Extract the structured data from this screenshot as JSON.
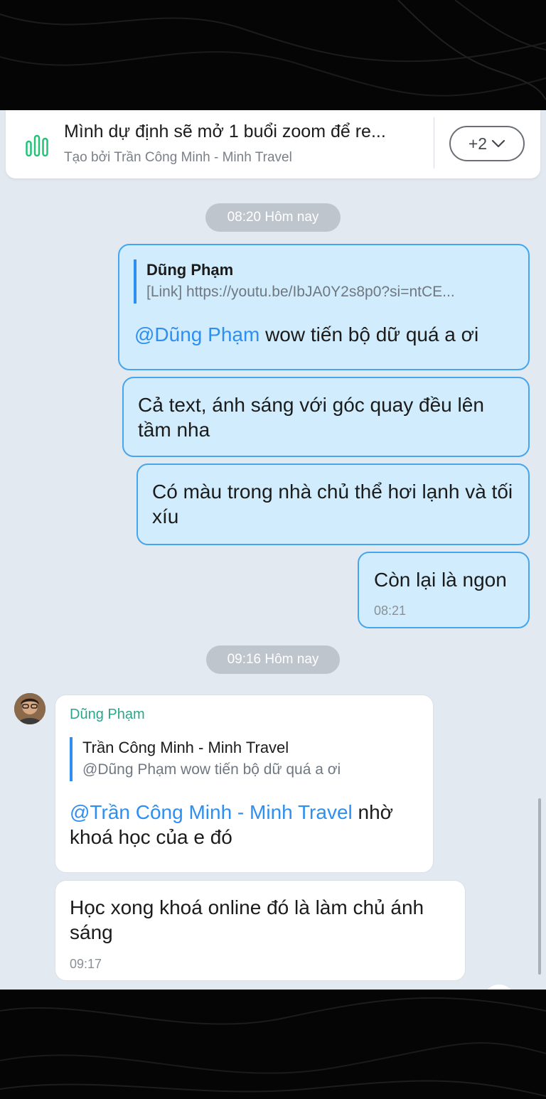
{
  "pinned": {
    "icon": "poll-icon",
    "title": "Mình dự định sẽ mở 1 buổi zoom  để re...",
    "subtitle": "Tạo bởi Trần Công Minh - Minh Travel",
    "more_label": "+2",
    "more_icon": "chevron-down-icon"
  },
  "messages": {
    "sep1": "08:20 Hôm nay",
    "m1": {
      "quote_author": "Dũng Phạm",
      "quote_text": "[Link] https://youtu.be/IbJA0Y2s8p0?si=ntCE...",
      "mention": "@Dũng Phạm",
      "text": " wow tiến bộ dữ quá a ơi"
    },
    "m2": {
      "text": "Cả text, ánh sáng với góc quay đều lên tầm nha"
    },
    "m3": {
      "text": "Có màu trong nhà chủ thể hơi lạnh và tối xíu"
    },
    "m4": {
      "text": "Còn lại là ngon",
      "time": "08:21"
    },
    "sep2": "09:16 Hôm nay",
    "m5": {
      "sender": "Dũng Phạm",
      "quote_author": "Trần Công Minh - Minh Travel",
      "quote_text": "@Dũng Phạm wow tiến bộ dữ quá a ơi",
      "mention": "@Trần Công Minh - Minh Travel",
      "text": " nhờ khoá học của e đó"
    },
    "m6": {
      "text": "Học xong khoá online đó là làm chủ ánh sáng",
      "time": "09:17"
    }
  },
  "colors": {
    "outgoing_bubble": "#d1ecfc",
    "outgoing_border": "#45a5ee",
    "mention": "#2f8ff0",
    "sender_name": "#2ca58c",
    "chat_background": "#e3e9f0"
  }
}
